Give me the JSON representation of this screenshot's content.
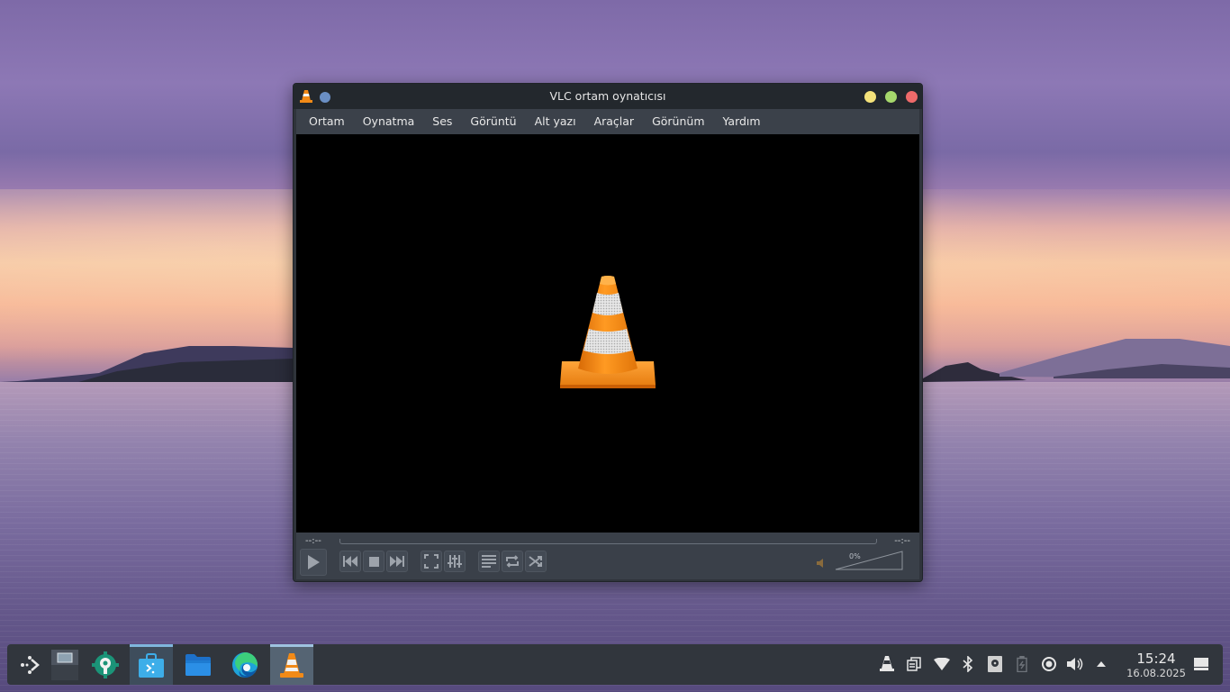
{
  "window": {
    "title": "VLC ortam oynatıcısı"
  },
  "menu": [
    {
      "label": "Ortam"
    },
    {
      "label": "Oynatma"
    },
    {
      "label": "Ses"
    },
    {
      "label": "Görüntü"
    },
    {
      "label": "Alt yazı"
    },
    {
      "label": "Araçlar"
    },
    {
      "label": "Görünüm"
    },
    {
      "label": "Yardım"
    }
  ],
  "player": {
    "elapsed": "--:--",
    "remaining": "--:--",
    "volume_label": "0%"
  },
  "taskbar": {
    "time": "15:24",
    "date": "16.08.2025"
  },
  "colors": {
    "accent": "#7fb6dc",
    "vlc_orange": "#f28a17",
    "close": "#ee6a6a",
    "minimize": "#f4e27a",
    "maximize": "#a6d86c"
  }
}
